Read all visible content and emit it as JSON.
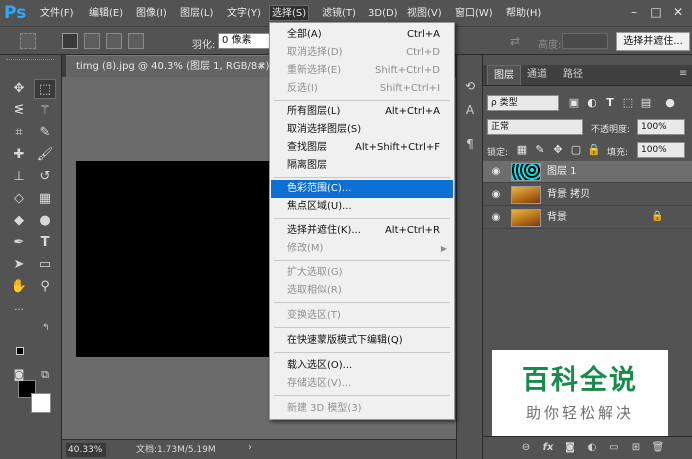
{
  "app": {
    "logo": "Ps"
  },
  "menubar": {
    "items": [
      "文件(F)",
      "编辑(E)",
      "图像(I)",
      "图层(L)",
      "文字(Y)",
      "选择(S)",
      "滤镜(T)",
      "3D(D)",
      "视图(V)",
      "窗口(W)",
      "帮助(H)"
    ],
    "active": "选择(S)",
    "window_controls": [
      "–",
      "□",
      "✕"
    ]
  },
  "options_bar": {
    "feather_label": "羽化:",
    "feather_value": "0 像素",
    "height_label": "高度:",
    "select_and_mask": "选择并遮住..."
  },
  "document": {
    "tab_title": "timg (8).jpg @ 40.3% (图层 1, RGB/8#) *",
    "tab_close": "×",
    "zoom": "40.33%",
    "doc_size": "文档:1.73M/5.19M"
  },
  "select_menu": {
    "items": [
      {
        "label": "全部(A)",
        "shortcut": "Ctrl+A",
        "disabled": false
      },
      {
        "label": "取消选择(D)",
        "shortcut": "Ctrl+D",
        "disabled": true
      },
      {
        "label": "重新选择(E)",
        "shortcut": "Shift+Ctrl+D",
        "disabled": true
      },
      {
        "label": "反选(I)",
        "shortcut": "Shift+Ctrl+I",
        "disabled": true
      },
      {
        "label": "所有图层(L)",
        "shortcut": "Alt+Ctrl+A",
        "disabled": false
      },
      {
        "label": "取消选择图层(S)",
        "shortcut": "",
        "disabled": false
      },
      {
        "label": "查找图层",
        "shortcut": "Alt+Shift+Ctrl+F",
        "disabled": false
      },
      {
        "label": "隔离图层",
        "shortcut": "",
        "disabled": false
      },
      {
        "label": "色彩范围(C)...",
        "shortcut": "",
        "disabled": false,
        "highlighted": true
      },
      {
        "label": "焦点区域(U)...",
        "shortcut": "",
        "disabled": false
      },
      {
        "label": "选择并遮住(K)...",
        "shortcut": "Alt+Ctrl+R",
        "disabled": false
      },
      {
        "label": "修改(M)",
        "shortcut": "",
        "disabled": true,
        "submenu": true
      },
      {
        "label": "扩大选取(G)",
        "shortcut": "",
        "disabled": true
      },
      {
        "label": "选取相似(R)",
        "shortcut": "",
        "disabled": true
      },
      {
        "label": "变换选区(T)",
        "shortcut": "",
        "disabled": true
      },
      {
        "label": "在快速蒙版模式下编辑(Q)",
        "shortcut": "",
        "disabled": false
      },
      {
        "label": "载入选区(O)...",
        "shortcut": "",
        "disabled": false
      },
      {
        "label": "存储选区(V)...",
        "shortcut": "",
        "disabled": true
      },
      {
        "label": "新建 3D 模型(3)",
        "shortcut": "",
        "disabled": true
      }
    ]
  },
  "layers_panel": {
    "tabs": [
      "图层",
      "通道",
      "路径"
    ],
    "filter_kind": "ρ 类型",
    "blend_mode": "正常",
    "opacity_label": "不透明度:",
    "opacity_value": "100%",
    "lock_label": "锁定:",
    "fill_label": "填充:",
    "fill_value": "100%",
    "layers": [
      {
        "name": "图层 1",
        "active": true,
        "locked": false
      },
      {
        "name": "背景 拷贝",
        "active": false,
        "locked": false
      },
      {
        "name": "背景",
        "active": false,
        "locked": true
      }
    ]
  },
  "watermark": {
    "title": "百科全说",
    "subtitle": "助你轻松解决"
  },
  "colors": {
    "menu_highlight": "#0b6fd6",
    "watermark_green": "#1a8a4a",
    "artwork_cyan": "#00e6ee"
  }
}
